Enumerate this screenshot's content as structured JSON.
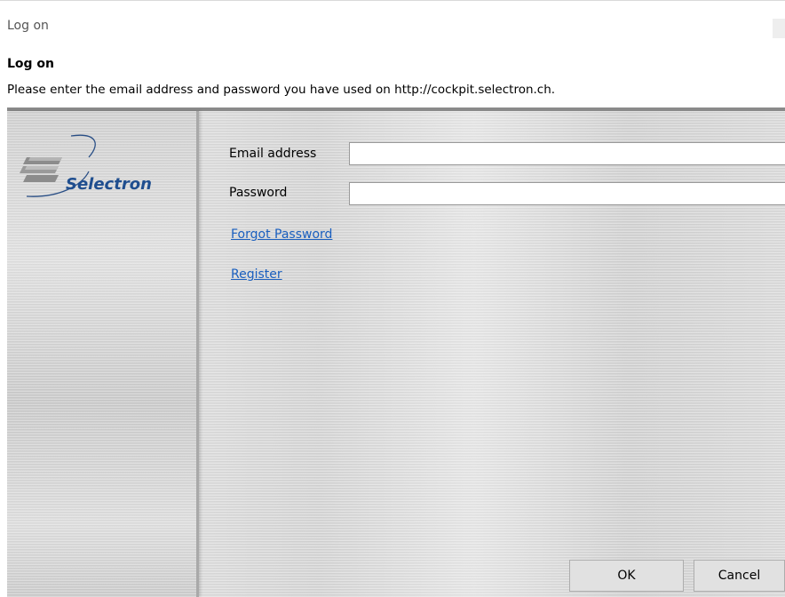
{
  "window": {
    "title": "Log on"
  },
  "dialog": {
    "heading": "Log on",
    "instruction": "Please enter the email address and password you have used on http://cockpit.selectron.ch."
  },
  "brand": {
    "name": "Selectron",
    "color": "#1f4e8f"
  },
  "form": {
    "email_label": "Email address",
    "email_value": "",
    "password_label": "Password",
    "password_value": "",
    "forgot_password_link": "Forgot Password",
    "register_link": "Register"
  },
  "buttons": {
    "ok_label": "OK",
    "cancel_label": "Cancel"
  },
  "colors": {
    "link": "#1a5fbf"
  }
}
